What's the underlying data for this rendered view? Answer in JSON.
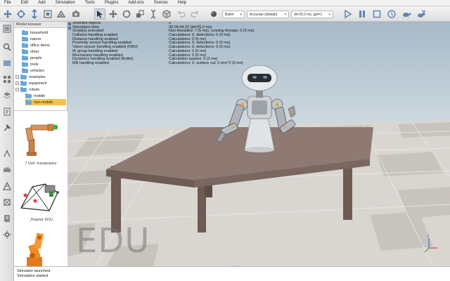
{
  "menu": [
    "File",
    "Edit",
    "Add",
    "Simulation",
    "Tools",
    "Plugins",
    "Add-ons",
    "Scenes",
    "Help"
  ],
  "toolbar": {
    "physics_engine": "Bullet",
    "accuracy": "Accurate (default)",
    "timestep": "dt=25.0 ms, ppf=1",
    "icons": [
      "move-camera",
      "rotate-camera",
      "zoom-camera",
      "view-fit",
      "camera-angle",
      "select",
      "object-shift",
      "object-rotate",
      "assembly",
      "transfer-dna",
      "undo",
      "redo",
      "dynamics",
      "physics-engine",
      "accuracy",
      "timestep",
      "start-simulation",
      "pause-simulation",
      "stop-simulation",
      "real-time",
      "turtle-slow",
      "rabbit-fast"
    ]
  },
  "left_toolbar": {
    "icons": [
      "model-browser",
      "scene-hierarchy",
      "page-selector",
      "scene-selector",
      "layer-selector",
      "script-editor",
      "tool-settings",
      "calculation-modules",
      "collection-modules",
      "polygon-modules",
      "shape-modules",
      "user-settings"
    ]
  },
  "browser": {
    "title": "Model browser",
    "tree": [
      {
        "label": "household",
        "level": 1
      },
      {
        "label": "nature",
        "level": 1
      },
      {
        "label": "office items",
        "level": 1
      },
      {
        "label": "other",
        "level": 1
      },
      {
        "label": "people",
        "level": 1
      },
      {
        "label": "tools",
        "level": 1
      },
      {
        "label": "vehicles",
        "level": 1
      },
      {
        "label": "examples",
        "level": 0
      },
      {
        "label": "equipment",
        "level": 0
      },
      {
        "label": "robots",
        "level": 0
      },
      {
        "label": "mobile",
        "level": 1
      },
      {
        "label": "non-mobile",
        "level": 1
      }
    ],
    "thumbnails": [
      "7 DoF manipulator",
      "_Raqnar EDU"
    ]
  },
  "info": [
    {
      "key": "Selected objects",
      "value": "0"
    },
    {
      "key": "Simulation time:",
      "value": "00:06:44.23 (dt=25.0 ms)"
    },
    {
      "key": "Script(s) executed",
      "value": "Non-threaded: 7 (5 ms), running threads: 0 (0 ms)"
    },
    {
      "key": "Collision handling enabled",
      "value": "Calculations: 0, detections: 0 (0 ms)"
    },
    {
      "key": "Distance handling enabled",
      "value": "Calculations: 0 (0 ms)"
    },
    {
      "key": "Proximity sensor handling enabled",
      "value": "Calculations: 0, detections: 0 (0 ms)"
    },
    {
      "key": "Vision sensor handling enabled (FBO)",
      "value": "Calculations: 0, detections: 0 (0 ms)"
    },
    {
      "key": "IK group handling enabled",
      "value": "Calculations: 0 (0 ms)"
    },
    {
      "key": "Mechanism handling enabled",
      "value": "Calculations: 0 (0 ms)"
    },
    {
      "key": "Dynamics handling enabled (Bullet)",
      "value": "Calculation passes: 5 (3 ms)"
    },
    {
      "key": "Mill handling enabled",
      "value": "Calculations: 0, surface cut: 0 mm^2 (0 ms)"
    }
  ],
  "watermark": "EDU",
  "status": [
    "Simulator launched.",
    "Simulation started."
  ],
  "colors": {
    "accent": "#6aa8d8",
    "selected": "#f5c34a",
    "table": "#8e7a72"
  }
}
